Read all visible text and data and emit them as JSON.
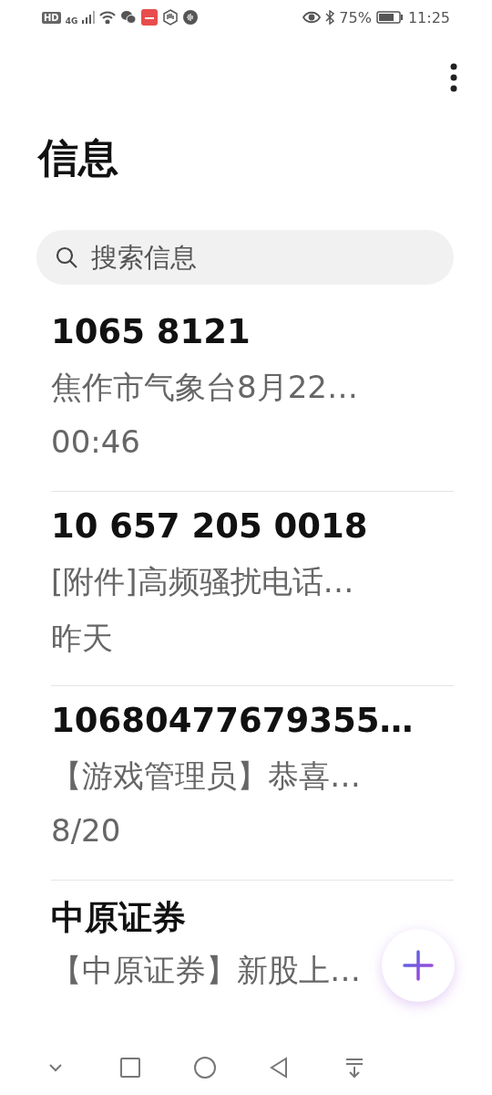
{
  "status_bar": {
    "battery_percent": "75%",
    "time": "11:25",
    "network": "4G",
    "hd": "HD"
  },
  "title": "信息",
  "search": {
    "placeholder": "搜索信息"
  },
  "conversations": [
    {
      "sender": "1065 8121",
      "preview": "焦作市气象台8月22…",
      "time": "00:46"
    },
    {
      "sender": "10 657 205 0018",
      "preview": "[附件]高频骚扰电话…",
      "time": "昨天"
    },
    {
      "sender": "10680477679355…",
      "preview": "【游戏管理员】恭喜…",
      "time": "8/20"
    },
    {
      "sender": "中原证券",
      "preview": "【中原证券】新股上…"
    }
  ]
}
